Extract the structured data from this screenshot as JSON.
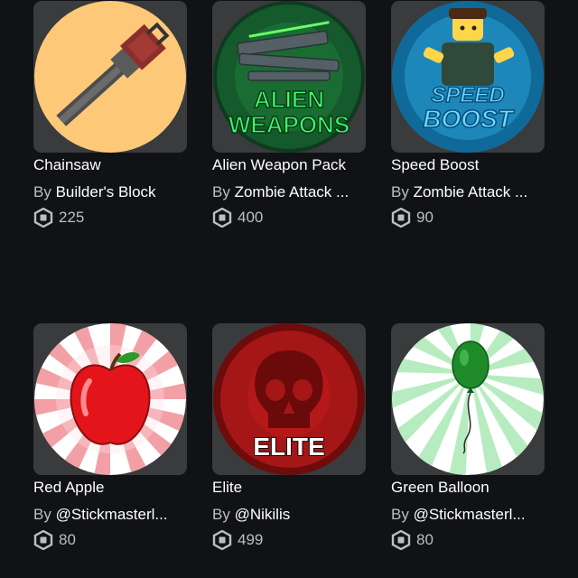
{
  "items": [
    {
      "name": "Chainsaw",
      "by": "By",
      "creator": "Builder's Block",
      "price": "225",
      "thumb_icon": "chainsaw-thumbnail"
    },
    {
      "name": "Alien Weapon Pack",
      "by": "By",
      "creator": "Zombie Attack ...",
      "price": "400",
      "thumb_icon": "alien-weapons-thumbnail",
      "thumb_text": [
        "ALIEN",
        "WEAPONS"
      ]
    },
    {
      "name": "Speed Boost",
      "by": "By",
      "creator": "Zombie Attack ...",
      "price": "90",
      "thumb_icon": "speed-boost-thumbnail",
      "thumb_text": [
        "SPEED",
        "BOOST"
      ]
    },
    {
      "name": "Red Apple",
      "by": "By",
      "creator": "@Stickmasterl...",
      "price": "80",
      "thumb_icon": "red-apple-thumbnail"
    },
    {
      "name": "Elite",
      "by": "By",
      "creator": "@Nikilis",
      "price": "499",
      "thumb_icon": "elite-skull-thumbnail",
      "thumb_text": [
        "ELITE"
      ]
    },
    {
      "name": "Green Balloon",
      "by": "By",
      "creator": "@Stickmasterl...",
      "price": "80",
      "thumb_icon": "green-balloon-thumbnail"
    }
  ],
  "currency_icon": "robux-icon",
  "colors": {
    "background": "#111216",
    "thumb_bg": "#393b3d",
    "secondary_text": "#bdbec0"
  }
}
